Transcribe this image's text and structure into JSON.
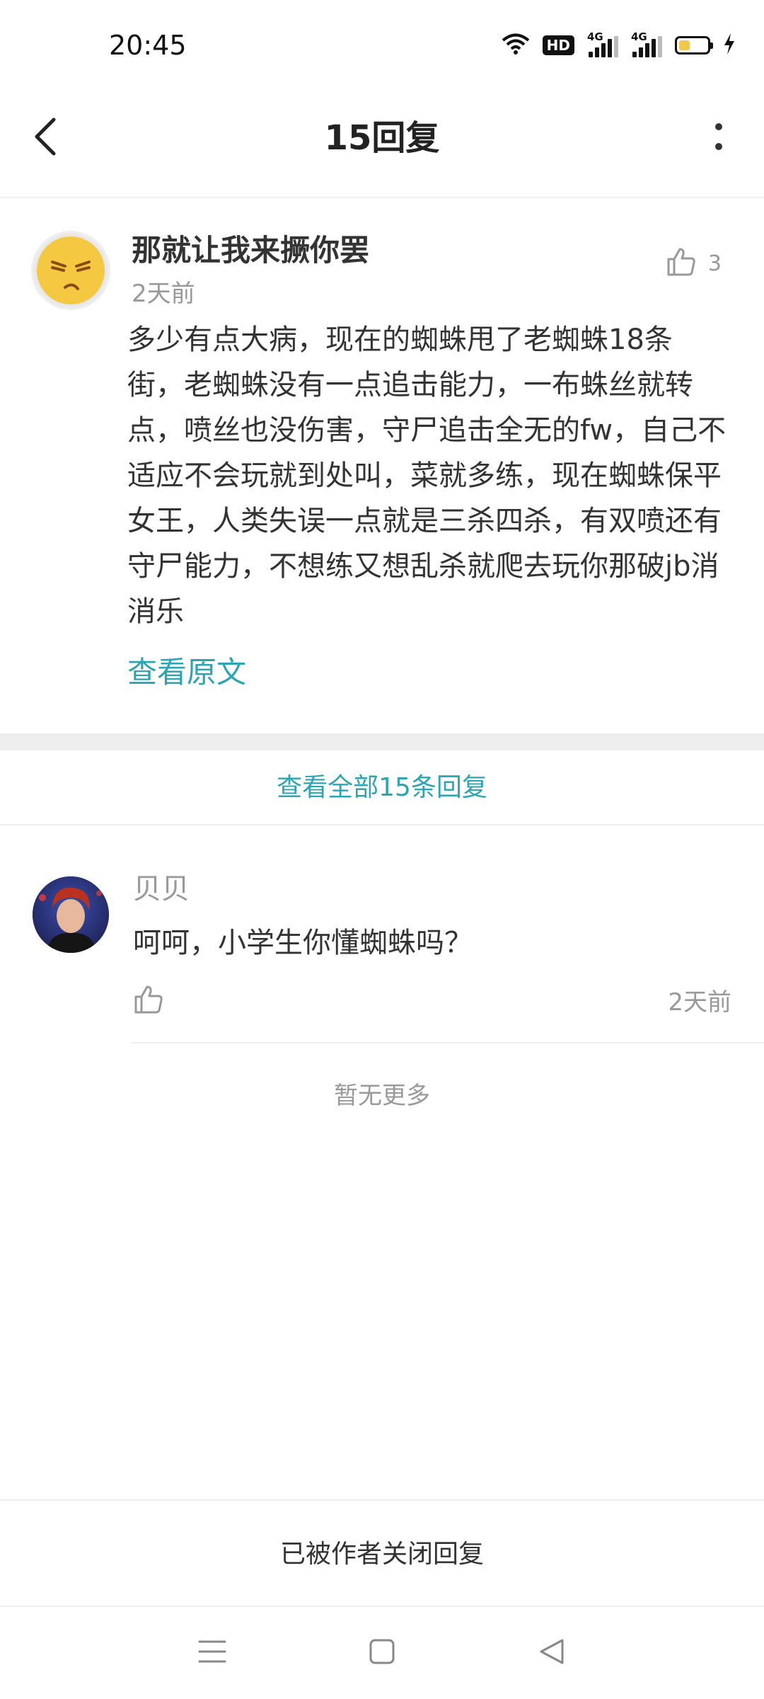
{
  "status_bar": {
    "time": "20:45",
    "network_label_1": "4G",
    "network_label_2": "4G",
    "hd_label": "HD",
    "battery_level": 0.35,
    "icons": [
      "wifi-icon",
      "hd-icon",
      "signal-icon",
      "signal-icon",
      "battery-icon",
      "charging-icon"
    ]
  },
  "header": {
    "title": "15回复",
    "back_icon": "chevron-left-icon",
    "more_icon": "more-vertical-icon"
  },
  "comment": {
    "author": "那就让我来撅你罢",
    "time": "2天前",
    "likes": "3",
    "like_icon": "thumbs-up-icon",
    "body": "多少有点大病，现在的蜘蛛甩了老蜘蛛18条街，老蜘蛛没有一点追击能力，一布蛛丝就转点，喷丝也没伤害，守尸追击全无的fw，自己不适应不会玩就到处叫，菜就多练，现在蜘蛛保平女王，人类失误一点就是三杀四杀，有双喷还有守尸能力，不想练又想乱杀就爬去玩你那破jb消消乐",
    "view_original": "查看原文"
  },
  "view_all_replies": "查看全部15条回复",
  "reply": {
    "author": "贝贝",
    "text": "呵呵，小学生你懂蜘蛛吗？",
    "time": "2天前",
    "like_icon": "thumbs-up-icon"
  },
  "no_more": "暂无更多",
  "footer": {
    "replies_closed": "已被作者关闭回复"
  },
  "nav_bar": {
    "icons": [
      "menu-icon",
      "home-square-icon",
      "back-triangle-icon"
    ]
  },
  "colors": {
    "accent": "#2ba5b3",
    "text_primary": "#333333",
    "text_secondary": "#999999"
  }
}
